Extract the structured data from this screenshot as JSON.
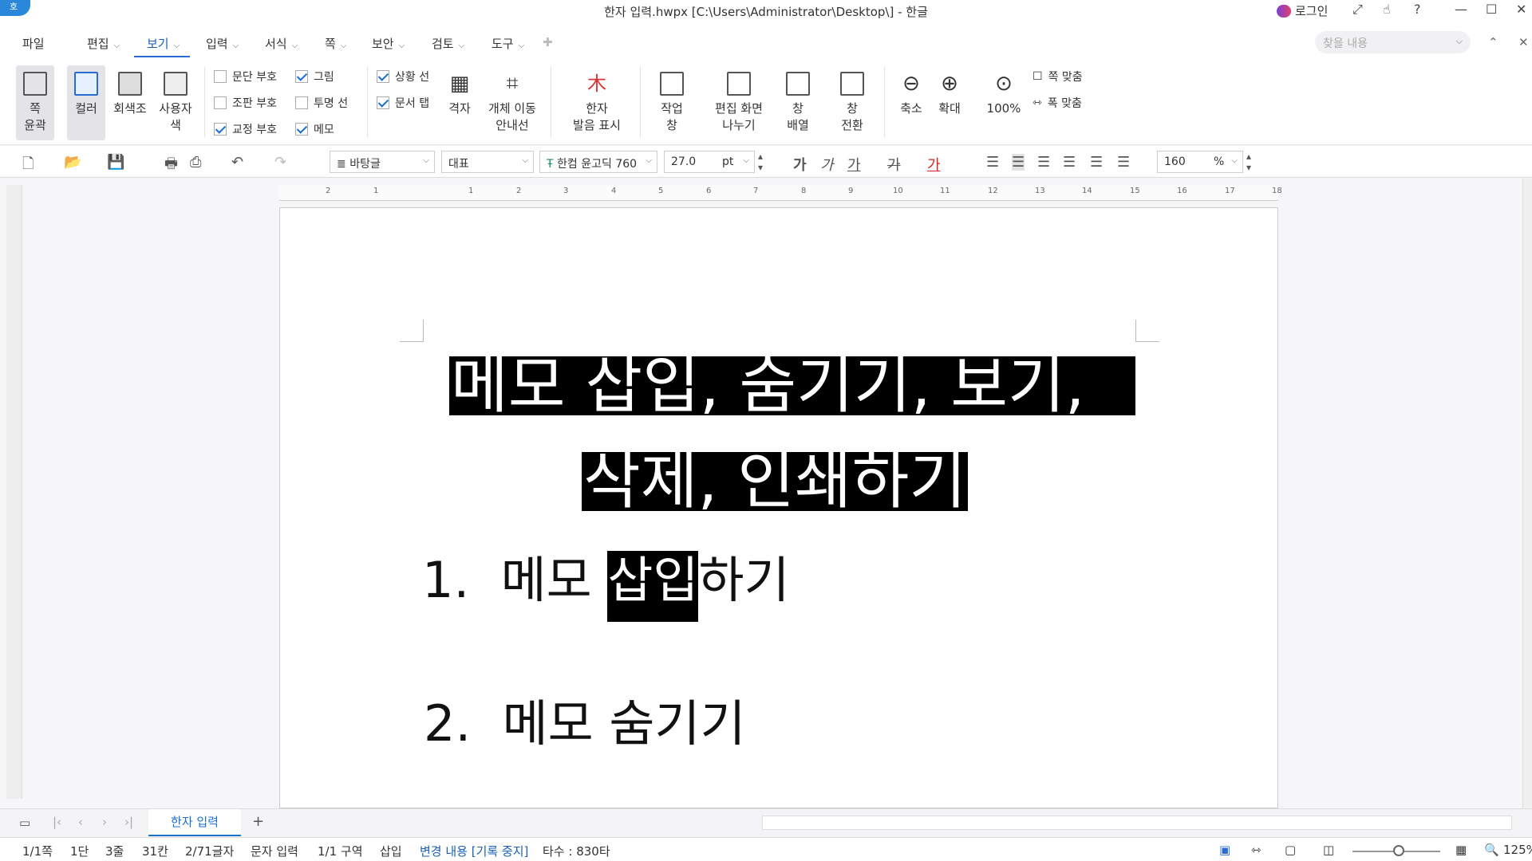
{
  "window": {
    "app_logo": "호",
    "title": "한자 입력.hwpx [C:\\Users\\Administrator\\Desktop\\] - 한글",
    "login": "로그인"
  },
  "menu": {
    "items": [
      "파일",
      "편집",
      "보기",
      "입력",
      "서식",
      "쪽",
      "보안",
      "검토",
      "도구"
    ],
    "active": "보기",
    "search_placeholder": "찾을 내용"
  },
  "ribbon": {
    "view_buttons": [
      {
        "label1": "쪽",
        "label2": "윤곽"
      },
      {
        "label1": "컬러",
        "label2": ""
      },
      {
        "label1": "회색조",
        "label2": ""
      },
      {
        "label1": "사용자",
        "label2": "색"
      }
    ],
    "checkboxes": [
      {
        "label": "문단 부호",
        "checked": false
      },
      {
        "label": "조판 부호",
        "checked": false
      },
      {
        "label": "교정 부호",
        "checked": true
      },
      {
        "label": "그림",
        "checked": true
      },
      {
        "label": "투명 선",
        "checked": false
      },
      {
        "label": "메모",
        "checked": true
      },
      {
        "label": "상황 선",
        "checked": true
      },
      {
        "label": "문서 탭",
        "checked": true
      }
    ],
    "buttons": [
      {
        "label1": "격자",
        "label2": ""
      },
      {
        "label1": "개체 이동",
        "label2": "안내선"
      },
      {
        "label1": "한자",
        "label2": "발음 표시"
      },
      {
        "label1": "작업",
        "label2": "창"
      },
      {
        "label1": "편집 화면",
        "label2": "나누기"
      },
      {
        "label1": "창",
        "label2": "배열"
      },
      {
        "label1": "창",
        "label2": "전환"
      },
      {
        "label1": "축소",
        "label2": ""
      },
      {
        "label1": "확대",
        "label2": ""
      },
      {
        "label1": "100%",
        "label2": ""
      }
    ],
    "fit_buttons": [
      "쪽 맞춤",
      "폭 맞춤"
    ]
  },
  "toolbar": {
    "style": "바탕글",
    "lang": "대표",
    "font": "한컴 윤고딕 760",
    "size": "27.0",
    "unit": "pt",
    "zoom": "160",
    "zoom_unit": "%",
    "text_glyph": "가"
  },
  "ruler": {
    "ticks": [
      "2",
      "1",
      "",
      "1",
      "2",
      "3",
      "4",
      "5",
      "6",
      "7",
      "8",
      "9",
      "10",
      "11",
      "12",
      "13",
      "14",
      "15",
      "16",
      "17",
      "18"
    ]
  },
  "document": {
    "heading_line1": "메모 삽입, 숨기기, 보기,",
    "heading_line2": "삭제, 인쇄하기",
    "item1_num": "1.",
    "item1_pre": "메모 ",
    "item1_hl": "삽입",
    "item1_post": "하기",
    "item2_num": "2.",
    "item2_text": "메모 숨기기"
  },
  "tabs": {
    "active_tab": "한자 입력",
    "add": "+"
  },
  "status": {
    "page": "1/1쪽",
    "column": "1단",
    "line": "3줄",
    "col": "31칸",
    "chars": "2/71글자",
    "input_mode": "문자 입력",
    "section": "1/1 구역",
    "insert": "삽입",
    "track": "변경 내용 [기록 중지]",
    "typing": "타수 : 830타",
    "zoom": "125%"
  }
}
